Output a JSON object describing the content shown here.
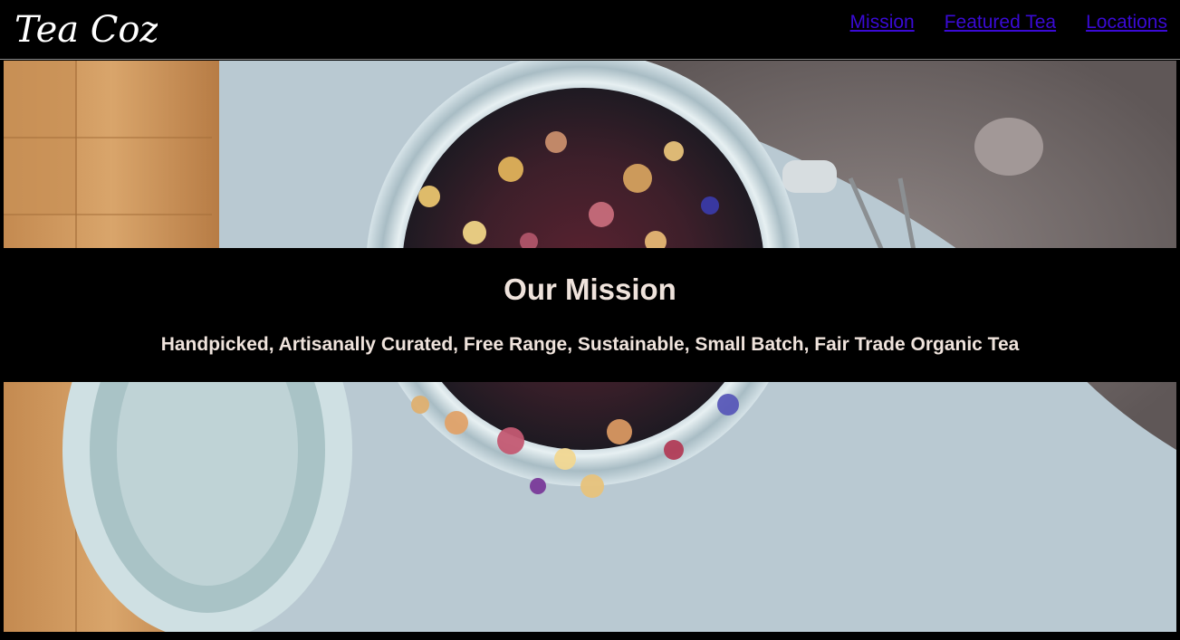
{
  "brand": {
    "logo_text": "Tea Cozy"
  },
  "nav": {
    "items": [
      {
        "label": "Mission"
      },
      {
        "label": "Featured Tea"
      },
      {
        "label": "Locations"
      }
    ],
    "link_color": "#3a0ad6"
  },
  "mission": {
    "heading": "Our Mission",
    "tagline": "Handpicked, Artisanally Curated, Free Range, Sustainable, Small Batch, Fair Trade Organic Tea"
  },
  "hero": {
    "image_subject": "open-glass-jar-of-loose-leaf-tea"
  },
  "colors": {
    "background": "#000000",
    "text": "#efe3dc"
  }
}
